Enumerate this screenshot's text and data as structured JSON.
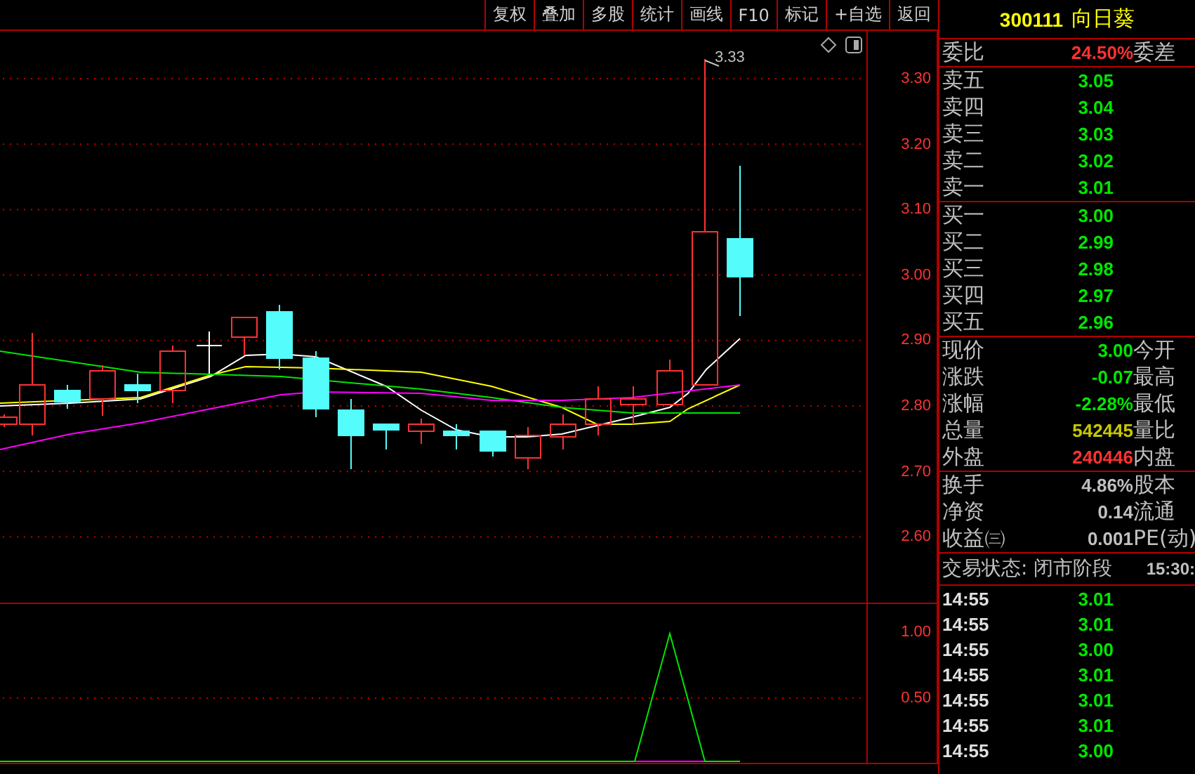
{
  "toolbar": {
    "buttons": [
      "复权",
      "叠加",
      "多股",
      "统计",
      "画线",
      "F10",
      "标记",
      "+自选",
      "返回"
    ]
  },
  "price_chart": {
    "high_label": "3.33",
    "axis_labels": [
      "3.30",
      "3.20",
      "3.10",
      "3.00",
      "2.90",
      "2.80",
      "2.70",
      "2.60"
    ]
  },
  "indicator": {
    "axis_labels": [
      "1.00",
      "0.50"
    ]
  },
  "quote": {
    "code": "300111",
    "name": "向日葵",
    "commission": {
      "label": "委比",
      "value": "24.50%",
      "color": "#ff3232",
      "right_label": "委差"
    },
    "asks": [
      {
        "label": "卖五",
        "price": "3.05"
      },
      {
        "label": "卖四",
        "price": "3.04"
      },
      {
        "label": "卖三",
        "price": "3.03"
      },
      {
        "label": "卖二",
        "price": "3.02"
      },
      {
        "label": "卖一",
        "price": "3.01"
      }
    ],
    "bids": [
      {
        "label": "买一",
        "price": "3.00"
      },
      {
        "label": "买二",
        "price": "2.99"
      },
      {
        "label": "买三",
        "price": "2.98"
      },
      {
        "label": "买四",
        "price": "2.97"
      },
      {
        "label": "买五",
        "price": "2.96"
      }
    ],
    "stats": [
      {
        "label": "现价",
        "value": "3.00",
        "color": "#00e600",
        "right_label": "今开"
      },
      {
        "label": "涨跌",
        "value": "-0.07",
        "color": "#00e600",
        "right_label": "最高"
      },
      {
        "label": "涨幅",
        "value": "-2.28%",
        "color": "#00e600",
        "right_label": "最低"
      },
      {
        "label": "总量",
        "value": "542445",
        "color": "#c8c800",
        "right_label": "量比"
      },
      {
        "label": "外盘",
        "value": "240446",
        "color": "#ff3232",
        "right_label": "内盘"
      }
    ],
    "fundamentals": [
      {
        "label": "换手",
        "value": "4.86%",
        "right_label": "股本"
      },
      {
        "label": "净资",
        "value": "0.14",
        "right_label": "流通"
      },
      {
        "label": "收益㈢",
        "value": "0.001",
        "right_label": "PE(动)"
      }
    ],
    "status": {
      "label": "交易状态: 闭市阶段",
      "time": "15:30:"
    },
    "ticks": [
      {
        "time": "14:55",
        "price": "3.01"
      },
      {
        "time": "14:55",
        "price": "3.01"
      },
      {
        "time": "14:55",
        "price": "3.00"
      },
      {
        "time": "14:55",
        "price": "3.01"
      },
      {
        "time": "14:55",
        "price": "3.01"
      },
      {
        "time": "14:55",
        "price": "3.01"
      },
      {
        "time": "14:55",
        "price": "3.00"
      }
    ]
  }
}
